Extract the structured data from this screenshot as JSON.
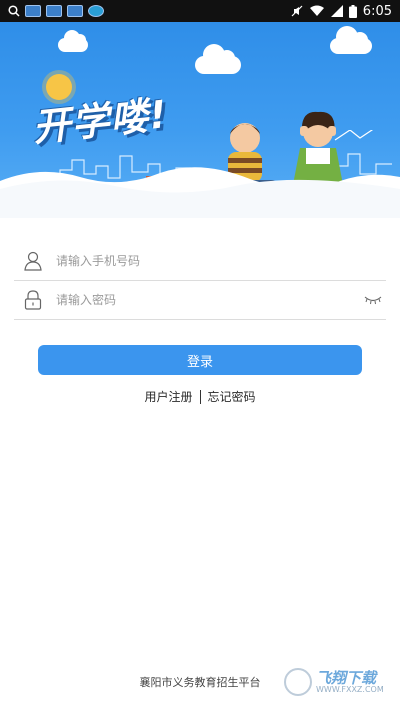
{
  "status_bar": {
    "time": "6:05",
    "left_icons": [
      "search-icon",
      "app-icon",
      "app-icon",
      "app-icon",
      "app-round-icon"
    ],
    "right_icons": [
      "mute-icon",
      "wifi-icon",
      "signal-icon",
      "battery-icon"
    ]
  },
  "banner": {
    "title": "开学喽!",
    "colors": {
      "sky": "#2f8ee8",
      "title_shadow": "#1f5fa8"
    }
  },
  "form": {
    "phone": {
      "placeholder": "请输入手机号码",
      "value": ""
    },
    "password": {
      "placeholder": "请输入密码",
      "value": ""
    },
    "login_label": "登录",
    "register_label": "用户注册",
    "forgot_label": "忘记密码"
  },
  "footer": {
    "text": "襄阳市义务教育招生平台"
  },
  "watermark": {
    "name": "飞翔下载",
    "url": "WWW.FXXZ.COM"
  },
  "accent_color": "#3b95ee"
}
